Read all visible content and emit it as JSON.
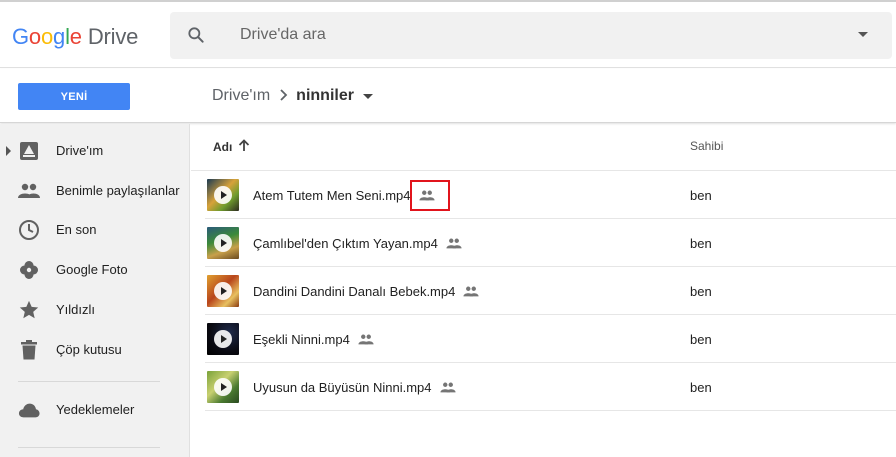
{
  "header": {
    "logo_google": [
      "G",
      "o",
      "o",
      "g",
      "l",
      "e"
    ],
    "logo_product": "Drive",
    "search_placeholder": "Drive'da ara"
  },
  "toolbar": {
    "new_label": "YENİ",
    "breadcrumb_root": "Drive'ım",
    "breadcrumb_current": "ninniler"
  },
  "sidebar": {
    "items": [
      {
        "label": "Drive'ım",
        "icon": "drive-icon"
      },
      {
        "label": "Benimle paylaşılanlar",
        "icon": "people-icon"
      },
      {
        "label": "En son",
        "icon": "clock-icon"
      },
      {
        "label": "Google Foto",
        "icon": "pinwheel-icon"
      },
      {
        "label": "Yıldızlı",
        "icon": "star-icon"
      },
      {
        "label": "Çöp kutusu",
        "icon": "trash-icon"
      },
      {
        "label": "Yedeklemeler",
        "icon": "cloud-icon"
      }
    ]
  },
  "columns": {
    "name": "Adı",
    "owner": "Sahibi"
  },
  "files": [
    {
      "name": "Atem Tutem Men Seni.mp4",
      "owner": "ben",
      "shared": true
    },
    {
      "name": "Çamlıbel'den Çıktım Yayan.mp4",
      "owner": "ben",
      "shared": true
    },
    {
      "name": "Dandini Dandini Danalı Bebek.mp4",
      "owner": "ben",
      "shared": true
    },
    {
      "name": "Eşekli Ninni.mp4",
      "owner": "ben",
      "shared": true
    },
    {
      "name": "Uyusun da Büyüsün Ninni.mp4",
      "owner": "ben",
      "shared": true
    }
  ],
  "colors": {
    "accent": "#4285f4",
    "highlight": "#e1141c",
    "sidebar_bg": "#f1f1f1"
  }
}
